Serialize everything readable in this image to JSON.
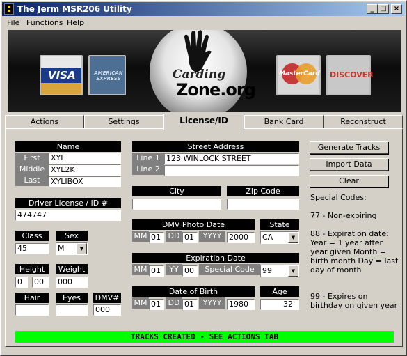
{
  "window": {
    "title": "The Jerm MSR206 Utility"
  },
  "titlebar_buttons": {
    "minimize": "_",
    "maximize": "□",
    "close": "×"
  },
  "menu": [
    "File",
    "Functions",
    "Help"
  ],
  "banner": {
    "visa": "VISA",
    "amex": "AMERICAN EXPRESS",
    "mastercard": "MasterCard",
    "discover": "DISCOVER",
    "logo_line1": "Carding",
    "logo_line2": "Zone.org"
  },
  "tabs": [
    "Actions",
    "Settings",
    "License/ID",
    "Bank Card",
    "Reconstruct"
  ],
  "active_tab": "License/ID",
  "name": {
    "header": "Name",
    "first_label": "First",
    "first": "XYL",
    "middle_label": "Middle",
    "middle": "XYL2K",
    "last_label": "Last",
    "last": "XYLIBOX"
  },
  "license": {
    "header": "Driver License / ID #",
    "value": "474747"
  },
  "class": {
    "header": "Class",
    "value": "45"
  },
  "sex": {
    "header": "Sex",
    "value": "M"
  },
  "height": {
    "header": "Height",
    "feet": "0",
    "inches": "00"
  },
  "weight": {
    "header": "Weight",
    "value": "000"
  },
  "hair": {
    "header": "Hair",
    "value": ""
  },
  "eyes": {
    "header": "Eyes",
    "value": ""
  },
  "dmv": {
    "header": "DMV#",
    "value": "000"
  },
  "address": {
    "header": "Street Address",
    "line1_label": "Line 1",
    "line1": "123 WINLOCK STREET",
    "line2_label": "Line 2",
    "line2": ""
  },
  "city": {
    "header": "City",
    "value": ""
  },
  "zip": {
    "header": "Zip Code",
    "value": ""
  },
  "photo_date": {
    "header": "DMV Photo Date",
    "mm_label": "MM",
    "mm": "01",
    "dd_label": "DD",
    "dd": "01",
    "yyyy_label": "YYYY",
    "yyyy": "2000"
  },
  "state": {
    "header": "State",
    "value": "CA"
  },
  "expiration": {
    "header": "Expiration Date",
    "mm_label": "MM",
    "mm": "01",
    "yy_label": "YY",
    "yy": "00",
    "special_label": "Special Code",
    "special": "99"
  },
  "dob": {
    "header": "Date of Birth",
    "mm_label": "MM",
    "mm": "01",
    "dd_label": "DD",
    "dd": "01",
    "yyyy_label": "YYYY",
    "yyyy": "1980"
  },
  "age": {
    "header": "Age",
    "value": "32"
  },
  "buttons": {
    "generate": "Generate Tracks",
    "import": "Import Data",
    "clear": "Clear"
  },
  "special_codes": {
    "title": "Special Codes:",
    "code77": "77 - Non-expiring",
    "code88": "88 - Expiration date: Year = 1 year after year given Month = birth month Day = last day of month",
    "code99": "99 - Expires on birthday on given year"
  },
  "status": "TRACKS CREATED - SEE ACTIONS TAB"
}
